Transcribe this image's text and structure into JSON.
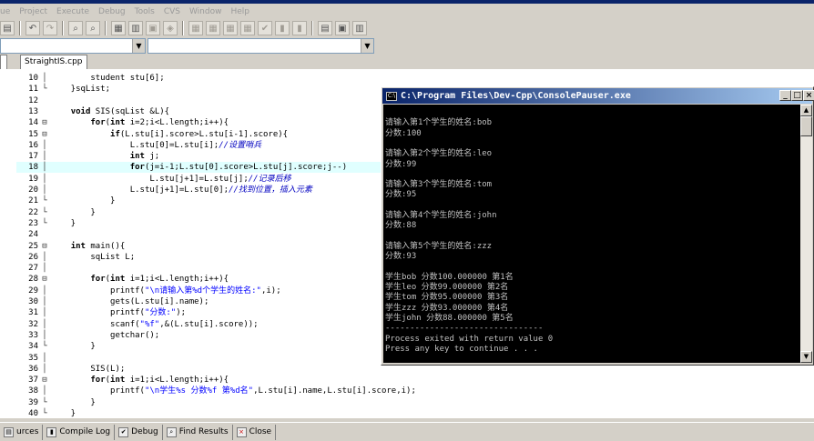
{
  "menu": [
    "ue",
    "Project",
    "Execute",
    "Debug",
    "Tools",
    "CVS",
    "Window",
    "Help"
  ],
  "file_tab": "StraightIS.cpp",
  "code_lines": [
    {
      "n": "10",
      "fold": "│",
      "html": "        student stu[6];"
    },
    {
      "n": "11",
      "fold": "└",
      "html": "    }sqList;"
    },
    {
      "n": "12",
      "fold": "",
      "html": ""
    },
    {
      "n": "13",
      "fold": "",
      "html": "    <b>void</b> SIS(sqList &amp;L){"
    },
    {
      "n": "14",
      "fold": "⊟",
      "html": "        <b>for</b>(<b>int</b> i=2;i&lt;L.length;i++){"
    },
    {
      "n": "15",
      "fold": "⊟",
      "html": "            <b>if</b>(L.stu[i].score&gt;L.stu[i-1].score){"
    },
    {
      "n": "16",
      "fold": "│",
      "html": "                L.stu[0]=L.stu[i];<span class=\"cm\">//<span class=\"cn\">设置哨兵</span></span>"
    },
    {
      "n": "17",
      "fold": "│",
      "html": "                <b>int</b> j;"
    },
    {
      "n": "18",
      "fold": "│",
      "html": "                <b>for</b>(j=i-1;L.stu[0].score&gt;L.stu[j].score;j--)"
    },
    {
      "n": "19",
      "fold": "│",
      "html": "                    L.stu[j+1]=L.stu[j];<span class=\"cm\">//<span class=\"cn\">记录后移</span></span>"
    },
    {
      "n": "20",
      "fold": "│",
      "html": "                L.stu[j+1]=L.stu[0];<span class=\"cm\">//<span class=\"cn\">找到位置，插入元素</span></span>"
    },
    {
      "n": "21",
      "fold": "└",
      "html": "            }"
    },
    {
      "n": "22",
      "fold": "└",
      "html": "        }"
    },
    {
      "n": "23",
      "fold": "└",
      "html": "    }"
    },
    {
      "n": "24",
      "fold": "",
      "html": ""
    },
    {
      "n": "25",
      "fold": "⊟",
      "html": "    <b>int</b> main(){"
    },
    {
      "n": "26",
      "fold": "│",
      "html": "        sqList L;"
    },
    {
      "n": "27",
      "fold": "│",
      "html": ""
    },
    {
      "n": "28",
      "fold": "⊟",
      "html": "        <b>for</b>(<b>int</b> i=1;i&lt;L.length;i++){"
    },
    {
      "n": "29",
      "fold": "│",
      "html": "            printf(<span class=\"str\">\"\\n<span class=\"cn\">请输入第</span>%d<span class=\"cn\">个学生的姓名</span>:\"</span>,i);"
    },
    {
      "n": "30",
      "fold": "│",
      "html": "            gets(L.stu[i].name);"
    },
    {
      "n": "31",
      "fold": "│",
      "html": "            printf(<span class=\"str\">\"<span class=\"cn\">分数</span>:\"</span>);"
    },
    {
      "n": "32",
      "fold": "│",
      "html": "            scanf(<span class=\"str\">\"%f\"</span>,&amp;(L.stu[i].score));"
    },
    {
      "n": "33",
      "fold": "│",
      "html": "            getchar();"
    },
    {
      "n": "34",
      "fold": "└",
      "html": "        }"
    },
    {
      "n": "35",
      "fold": "│",
      "html": ""
    },
    {
      "n": "36",
      "fold": "│",
      "html": "        SIS(L);"
    },
    {
      "n": "37",
      "fold": "⊟",
      "html": "        <b>for</b>(<b>int</b> i=1;i&lt;L.length;i++){"
    },
    {
      "n": "38",
      "fold": "│",
      "html": "            printf(<span class=\"str\">\"\\n<span class=\"cn\">学生</span>%s <span class=\"cn\">分数</span>%f <span class=\"cn\">第</span>%d<span class=\"cn\">名</span>\"</span>,L.stu[i].name,L.stu[i].score,i);"
    },
    {
      "n": "39",
      "fold": "└",
      "html": "        }"
    },
    {
      "n": "40",
      "fold": "└",
      "html": "    }"
    }
  ],
  "highlight_line": "18",
  "console": {
    "title": "C:\\Program Files\\Dev-Cpp\\ConsolePauser.exe",
    "lines": [
      "",
      "请输入第1个学生的姓名:bob",
      "分数:100",
      "",
      "请输入第2个学生的姓名:leo",
      "分数:99",
      "",
      "请输入第3个学生的姓名:tom",
      "分数:95",
      "",
      "请输入第4个学生的姓名:john",
      "分数:88",
      "",
      "请输入第5个学生的姓名:zzz",
      "分数:93",
      "",
      "学生bob 分数100.000000 第1名",
      "学生leo 分数99.000000 第2名",
      "学生tom 分数95.000000 第3名",
      "学生zzz 分数93.000000 第4名",
      "学生john 分数88.000000 第5名",
      "--------------------------------",
      "Process exited with return value 0",
      "Press any key to continue . . ."
    ]
  },
  "bottom_tabs": [
    {
      "label": "urces",
      "icon": "project-icon"
    },
    {
      "label": "Compile Log",
      "icon": "chart-icon"
    },
    {
      "label": "Debug",
      "icon": "check-icon"
    },
    {
      "label": "Find Results",
      "icon": "find-icon"
    },
    {
      "label": "Close",
      "icon": "close-icon"
    }
  ]
}
